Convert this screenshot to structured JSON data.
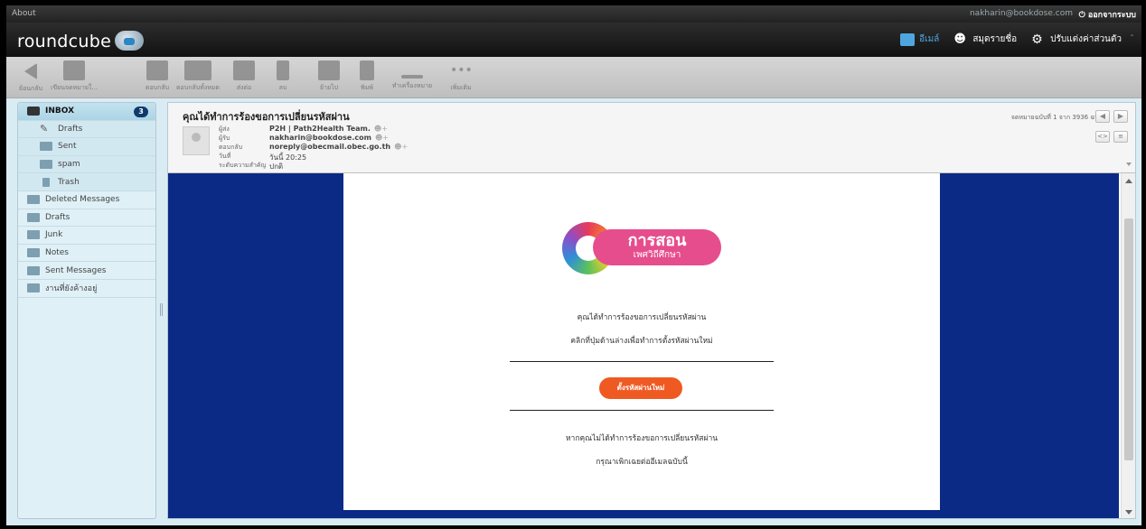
{
  "topline": {
    "about": "About",
    "user": "nakharin@bookdose.com",
    "logout": "ออกจากระบบ"
  },
  "header": {
    "logo": "roundcube",
    "nav": [
      {
        "label": "อีเมล์",
        "icon": "mail-icon",
        "active": true
      },
      {
        "label": "สมุดรายชื่อ",
        "icon": "contacts-icon",
        "active": false
      },
      {
        "label": "ปรับแต่งค่าส่วนตัว",
        "icon": "gear-icon",
        "active": false
      }
    ]
  },
  "toolbar": [
    {
      "label": "ย้อนกลับ",
      "icon": "back-icon"
    },
    {
      "label": "เขียนจดหมายใ...",
      "icon": "compose-icon"
    },
    {
      "label": "ตอบกลับ",
      "icon": "reply-icon"
    },
    {
      "label": "ตอบกลับทั้งหมด",
      "icon": "reply-all-icon"
    },
    {
      "label": "ส่งต่อ",
      "icon": "forward-icon"
    },
    {
      "label": "ลบ",
      "icon": "delete-icon"
    },
    {
      "label": "ย้ายไป",
      "icon": "move-icon"
    },
    {
      "label": "พิมพ์",
      "icon": "print-icon"
    },
    {
      "label": "ทำเครื่องหมาย",
      "icon": "mark-icon"
    },
    {
      "label": "เพิ่มเติม",
      "icon": "more-icon"
    }
  ],
  "folders": [
    {
      "label": "INBOX",
      "icon": "inbox-icon",
      "selected": true,
      "sub": false,
      "badge": "3"
    },
    {
      "label": "Drafts",
      "icon": "drafts-icon",
      "selected": false,
      "sub": true
    },
    {
      "label": "Sent",
      "icon": "sent-icon",
      "selected": false,
      "sub": true
    },
    {
      "label": "spam",
      "icon": "spam-icon",
      "selected": false,
      "sub": true
    },
    {
      "label": "Trash",
      "icon": "trash-icon",
      "selected": false,
      "sub": true
    },
    {
      "label": "Deleted Messages",
      "icon": "folder-icon",
      "selected": false,
      "sub": false
    },
    {
      "label": "Drafts",
      "icon": "folder-icon",
      "selected": false,
      "sub": false
    },
    {
      "label": "Junk",
      "icon": "folder-icon",
      "selected": false,
      "sub": false
    },
    {
      "label": "Notes",
      "icon": "folder-icon",
      "selected": false,
      "sub": false
    },
    {
      "label": "Sent Messages",
      "icon": "folder-icon",
      "selected": false,
      "sub": false
    },
    {
      "label": "งานที่ยังค้างอยู่",
      "icon": "folder-icon",
      "selected": false,
      "sub": false
    }
  ],
  "message": {
    "subject": "คุณได้ทำการร้องขอการเปลี่ยนรหัสผ่าน",
    "from_label": "ผู้ส่ง",
    "from": "P2H | Path2Health Team.",
    "to_label": "ผู้รับ",
    "to": "nakharin@bookdose.com",
    "replyto_label": "ตอบกลับ",
    "replyto": "noreply@obecmail.obec.go.th",
    "date_label": "วันที่",
    "date": "วันนี้ 20:25",
    "priority_label": "ระดับความสำคัญ",
    "priority": "ปกติ",
    "counter": "จดหมายฉบับที่ 1 จาก 3936 ฉบับ"
  },
  "email": {
    "logo_title": "การสอน",
    "logo_subtitle": "เพศวิถีศึกษา",
    "line1": "คุณได้ทำการร้องขอการเปลี่ยนรหัสผ่าน",
    "line2": "คลิกที่ปุ่มด้านล่างเพื่อทำการตั้งรหัสผ่านใหม่",
    "button": "ตั้งรหัสผ่านใหม่",
    "line3": "หากคุณไม่ได้ทำการร้องขอการเปลี่ยนรหัสผ่าน",
    "line4": "กรุณาเพิกเฉยต่ออีเมลฉบับนี้"
  },
  "colors": {
    "email_background": "#0b2a86",
    "button": "#ef5a22",
    "logo_pill": "#e64d8c",
    "badge": "#0e3a6c"
  }
}
